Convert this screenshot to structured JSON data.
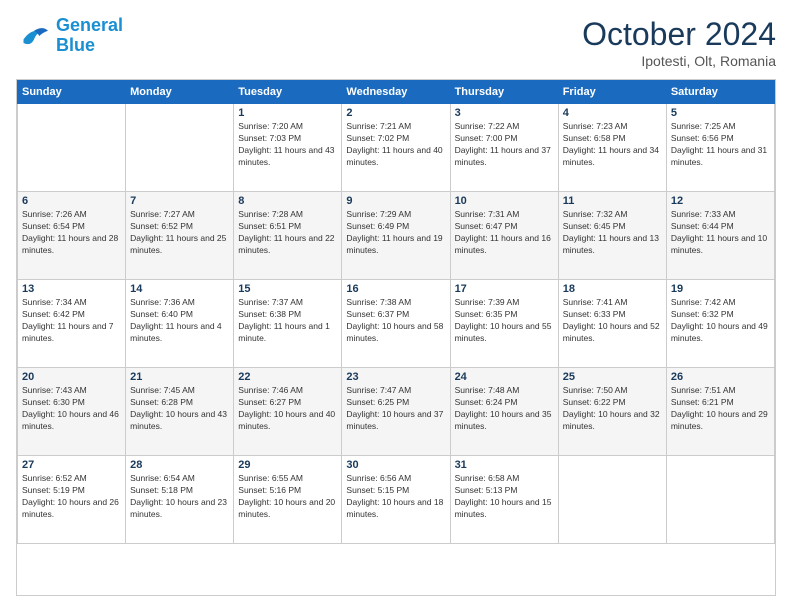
{
  "header": {
    "logo_line1": "General",
    "logo_line2": "Blue",
    "month": "October 2024",
    "location": "Ipotesti, Olt, Romania"
  },
  "weekdays": [
    "Sunday",
    "Monday",
    "Tuesday",
    "Wednesday",
    "Thursday",
    "Friday",
    "Saturday"
  ],
  "weeks": [
    [
      {
        "day": "",
        "info": ""
      },
      {
        "day": "",
        "info": ""
      },
      {
        "day": "1",
        "info": "Sunrise: 7:20 AM\nSunset: 7:03 PM\nDaylight: 11 hours and 43 minutes."
      },
      {
        "day": "2",
        "info": "Sunrise: 7:21 AM\nSunset: 7:02 PM\nDaylight: 11 hours and 40 minutes."
      },
      {
        "day": "3",
        "info": "Sunrise: 7:22 AM\nSunset: 7:00 PM\nDaylight: 11 hours and 37 minutes."
      },
      {
        "day": "4",
        "info": "Sunrise: 7:23 AM\nSunset: 6:58 PM\nDaylight: 11 hours and 34 minutes."
      },
      {
        "day": "5",
        "info": "Sunrise: 7:25 AM\nSunset: 6:56 PM\nDaylight: 11 hours and 31 minutes."
      }
    ],
    [
      {
        "day": "6",
        "info": "Sunrise: 7:26 AM\nSunset: 6:54 PM\nDaylight: 11 hours and 28 minutes."
      },
      {
        "day": "7",
        "info": "Sunrise: 7:27 AM\nSunset: 6:52 PM\nDaylight: 11 hours and 25 minutes."
      },
      {
        "day": "8",
        "info": "Sunrise: 7:28 AM\nSunset: 6:51 PM\nDaylight: 11 hours and 22 minutes."
      },
      {
        "day": "9",
        "info": "Sunrise: 7:29 AM\nSunset: 6:49 PM\nDaylight: 11 hours and 19 minutes."
      },
      {
        "day": "10",
        "info": "Sunrise: 7:31 AM\nSunset: 6:47 PM\nDaylight: 11 hours and 16 minutes."
      },
      {
        "day": "11",
        "info": "Sunrise: 7:32 AM\nSunset: 6:45 PM\nDaylight: 11 hours and 13 minutes."
      },
      {
        "day": "12",
        "info": "Sunrise: 7:33 AM\nSunset: 6:44 PM\nDaylight: 11 hours and 10 minutes."
      }
    ],
    [
      {
        "day": "13",
        "info": "Sunrise: 7:34 AM\nSunset: 6:42 PM\nDaylight: 11 hours and 7 minutes."
      },
      {
        "day": "14",
        "info": "Sunrise: 7:36 AM\nSunset: 6:40 PM\nDaylight: 11 hours and 4 minutes."
      },
      {
        "day": "15",
        "info": "Sunrise: 7:37 AM\nSunset: 6:38 PM\nDaylight: 11 hours and 1 minute."
      },
      {
        "day": "16",
        "info": "Sunrise: 7:38 AM\nSunset: 6:37 PM\nDaylight: 10 hours and 58 minutes."
      },
      {
        "day": "17",
        "info": "Sunrise: 7:39 AM\nSunset: 6:35 PM\nDaylight: 10 hours and 55 minutes."
      },
      {
        "day": "18",
        "info": "Sunrise: 7:41 AM\nSunset: 6:33 PM\nDaylight: 10 hours and 52 minutes."
      },
      {
        "day": "19",
        "info": "Sunrise: 7:42 AM\nSunset: 6:32 PM\nDaylight: 10 hours and 49 minutes."
      }
    ],
    [
      {
        "day": "20",
        "info": "Sunrise: 7:43 AM\nSunset: 6:30 PM\nDaylight: 10 hours and 46 minutes."
      },
      {
        "day": "21",
        "info": "Sunrise: 7:45 AM\nSunset: 6:28 PM\nDaylight: 10 hours and 43 minutes."
      },
      {
        "day": "22",
        "info": "Sunrise: 7:46 AM\nSunset: 6:27 PM\nDaylight: 10 hours and 40 minutes."
      },
      {
        "day": "23",
        "info": "Sunrise: 7:47 AM\nSunset: 6:25 PM\nDaylight: 10 hours and 37 minutes."
      },
      {
        "day": "24",
        "info": "Sunrise: 7:48 AM\nSunset: 6:24 PM\nDaylight: 10 hours and 35 minutes."
      },
      {
        "day": "25",
        "info": "Sunrise: 7:50 AM\nSunset: 6:22 PM\nDaylight: 10 hours and 32 minutes."
      },
      {
        "day": "26",
        "info": "Sunrise: 7:51 AM\nSunset: 6:21 PM\nDaylight: 10 hours and 29 minutes."
      }
    ],
    [
      {
        "day": "27",
        "info": "Sunrise: 6:52 AM\nSunset: 5:19 PM\nDaylight: 10 hours and 26 minutes."
      },
      {
        "day": "28",
        "info": "Sunrise: 6:54 AM\nSunset: 5:18 PM\nDaylight: 10 hours and 23 minutes."
      },
      {
        "day": "29",
        "info": "Sunrise: 6:55 AM\nSunset: 5:16 PM\nDaylight: 10 hours and 20 minutes."
      },
      {
        "day": "30",
        "info": "Sunrise: 6:56 AM\nSunset: 5:15 PM\nDaylight: 10 hours and 18 minutes."
      },
      {
        "day": "31",
        "info": "Sunrise: 6:58 AM\nSunset: 5:13 PM\nDaylight: 10 hours and 15 minutes."
      },
      {
        "day": "",
        "info": ""
      },
      {
        "day": "",
        "info": ""
      }
    ]
  ]
}
